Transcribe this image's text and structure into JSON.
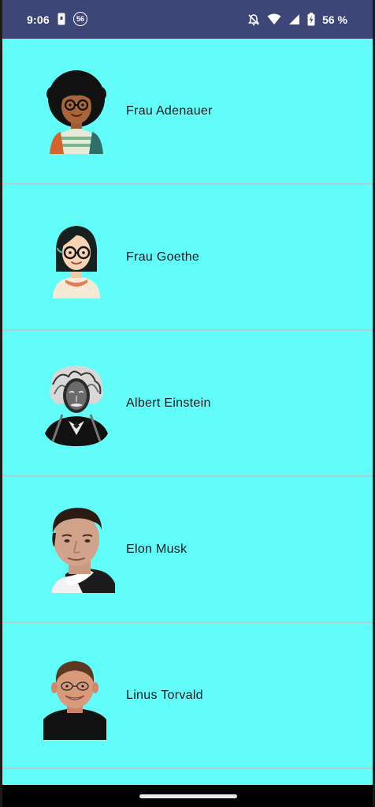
{
  "status_bar": {
    "time": "9:06",
    "sim_badge": "56",
    "battery_percent": "56 %",
    "icons": [
      "phone-notification-icon",
      "sim-badge-icon",
      "notifications-off-icon",
      "wifi-icon",
      "cell-signal-icon",
      "battery-icon"
    ]
  },
  "people": [
    {
      "name": "Frau Adenauer",
      "avatar": "cartoon-woman-curly-hair-glasses"
    },
    {
      "name": "Frau Goethe",
      "avatar": "cartoon-woman-bob-hair-glasses"
    },
    {
      "name": "Albert Einstein",
      "avatar": "einstein-ink-portrait"
    },
    {
      "name": "Elon Musk",
      "avatar": "elon-musk-photo"
    },
    {
      "name": "Linus Torvald",
      "avatar": "linus-torvalds-photo"
    }
  ],
  "colors": {
    "status_bar_bg": "#3e4577",
    "list_bg": "#63fdf9",
    "divider": "#a7d2cf"
  }
}
